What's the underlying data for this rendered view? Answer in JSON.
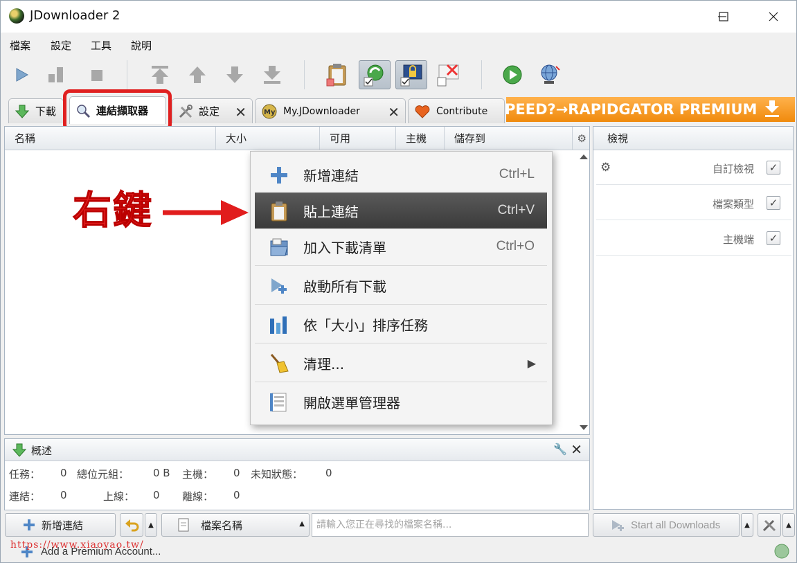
{
  "window": {
    "title": "JDownloader 2"
  },
  "menubar": {
    "items": [
      "檔案",
      "設定",
      "工具",
      "說明"
    ]
  },
  "tabs": [
    {
      "label": "下載"
    },
    {
      "label": "連結擷取器"
    },
    {
      "label": "設定"
    },
    {
      "label": "My.JDownloader"
    },
    {
      "label": "Contribute"
    }
  ],
  "ad_banner": "PEED?→RAPIDGATOR PREMIUM",
  "table": {
    "columns": [
      "名稱",
      "大小",
      "可用",
      "主機",
      "儲存到"
    ]
  },
  "right_panel": {
    "title": "檢視",
    "rows": [
      {
        "label": "自訂檢視",
        "checked": true
      },
      {
        "label": "檔案類型",
        "checked": true
      },
      {
        "label": "主機端",
        "checked": true
      }
    ]
  },
  "context_menu": {
    "items": [
      {
        "label": "新增連結",
        "shortcut": "Ctrl+L",
        "icon": "add-link-icon"
      },
      {
        "label": "貼上連結",
        "shortcut": "Ctrl+V",
        "icon": "clipboard-icon",
        "highlighted": true
      },
      {
        "label": "加入下載清單",
        "shortcut": "Ctrl+O",
        "icon": "open-folder-icon"
      },
      {
        "label": "啟動所有下載",
        "shortcut": "",
        "icon": "start-downloads-icon"
      },
      {
        "label": "依「大小」排序任務",
        "shortcut": "",
        "icon": "sort-icon"
      },
      {
        "label": "清理...",
        "shortcut": "",
        "icon": "broom-icon",
        "submenu": true
      },
      {
        "label": "開啟選單管理器",
        "shortcut": "",
        "icon": "menu-manager-icon"
      }
    ]
  },
  "annotation": {
    "text": "右鍵"
  },
  "overview": {
    "title": "概述",
    "stats": {
      "tasks_label": "任務：",
      "tasks": "0",
      "bytes_label": "總位元組：",
      "bytes": "0 B",
      "hosts_label": "主機：",
      "hosts": "0",
      "unknown_label": "未知狀態：",
      "unknown": "0",
      "links_label": "連結：",
      "links": "0",
      "online_label": "上線：",
      "online": "0",
      "offline_label": "離線：",
      "offline": "0"
    }
  },
  "bottombar": {
    "add_links": "新增連結",
    "filename_filter": "檔案名稱",
    "search_placeholder": "請輸入您正在尋找的檔案名稱...",
    "start_all": "Start all Downloads"
  },
  "statusbar": {
    "text": "Add a Premium Account...",
    "watermark": "https://www.xiaoyao.tw/"
  },
  "colors": {
    "accent_red": "#e02020",
    "banner_orange": "#f08a0d"
  }
}
